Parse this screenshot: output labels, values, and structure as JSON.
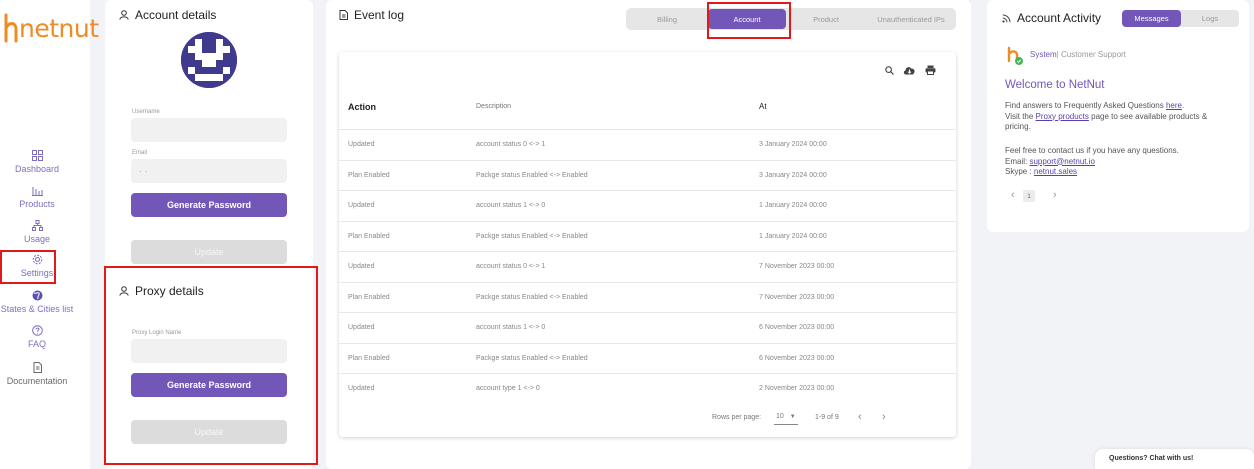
{
  "brand": {
    "name": "netnut",
    "color": "#f08a24"
  },
  "nav": [
    {
      "label": "Dashboard",
      "icon": "dashboard-icon"
    },
    {
      "label": "Products",
      "icon": "products-icon"
    },
    {
      "label": "Usage",
      "icon": "usage-icon"
    },
    {
      "label": "Settings",
      "icon": "settings-icon"
    },
    {
      "label": "States & Cities list",
      "icon": "globe-icon"
    },
    {
      "label": "FAQ",
      "icon": "help-icon"
    },
    {
      "label": "Documentation",
      "icon": "document-icon"
    }
  ],
  "account": {
    "title": "Account details",
    "username_label": "Username",
    "username_value": "",
    "email_label": "Email",
    "email_value": "· ·",
    "generate_label": "Generate Password",
    "update_label": "Update"
  },
  "proxy": {
    "title": "Proxy details",
    "login_label": "Proxy Login Name",
    "login_value": "",
    "generate_label": "Generate Password",
    "update_label": "Update"
  },
  "event_log": {
    "title": "Event log",
    "tabs": [
      "Billing",
      "Account",
      "Product",
      "Unauthenticated IPs"
    ],
    "active_tab": "Account",
    "columns": [
      "Action",
      "Description",
      "At"
    ],
    "rows": [
      [
        "Updated",
        "account status 0 <-> 1",
        "3 January 2024 00:00"
      ],
      [
        "Plan Enabled",
        "Packge status Enabled <-> Enabled",
        "3 January 2024 00:00"
      ],
      [
        "Updated",
        "account status 1 <-> 0",
        "1 January 2024 00:00"
      ],
      [
        "Plan Enabled",
        "Packge status Enabled <-> Enabled",
        "1 January 2024 00:00"
      ],
      [
        "Updated",
        "account status 0 <-> 1",
        "7 November 2023 00:00"
      ],
      [
        "Plan Enabled",
        "Packge status Enabled <-> Enabled",
        "7 November 2023 00:00"
      ],
      [
        "Updated",
        "account status 1 <-> 0",
        "6 November 2023 00:00"
      ],
      [
        "Plan Enabled",
        "Packge status Enabled <-> Enabled",
        "6 November 2023 00:00"
      ],
      [
        "Updated",
        "account type 1 <-> 0",
        "2 November 2023 00:00"
      ]
    ],
    "rows_per_page_label": "Rows per page:",
    "rows_per_page": "10",
    "range": "1-9 of 9"
  },
  "activity": {
    "title": "Account Activity",
    "tabs": [
      "Messages",
      "Logs"
    ],
    "sender_system": "System",
    "sender_name": "Customer Support",
    "heading": "Welcome to NetNut",
    "line1_pre": "Find answers to Frequently Asked Questions ",
    "line1_link": "here",
    "line1_post": ".",
    "line2_pre": "Visit the ",
    "line2_link": "Proxy products",
    "line2_post": " page to see available products &",
    "line3": "pricing.",
    "line4": "Feel free to contact us if you have any questions.",
    "email_pre": "Email: ",
    "email_link": "support@netnut.io",
    "skype_pre": "Skype : ",
    "skype_link": "netnut.sales",
    "page": "1"
  },
  "chat": {
    "label": "Questions? Chat with us!"
  },
  "colors": {
    "accent": "#7257b8",
    "annotation": "#e01919"
  }
}
